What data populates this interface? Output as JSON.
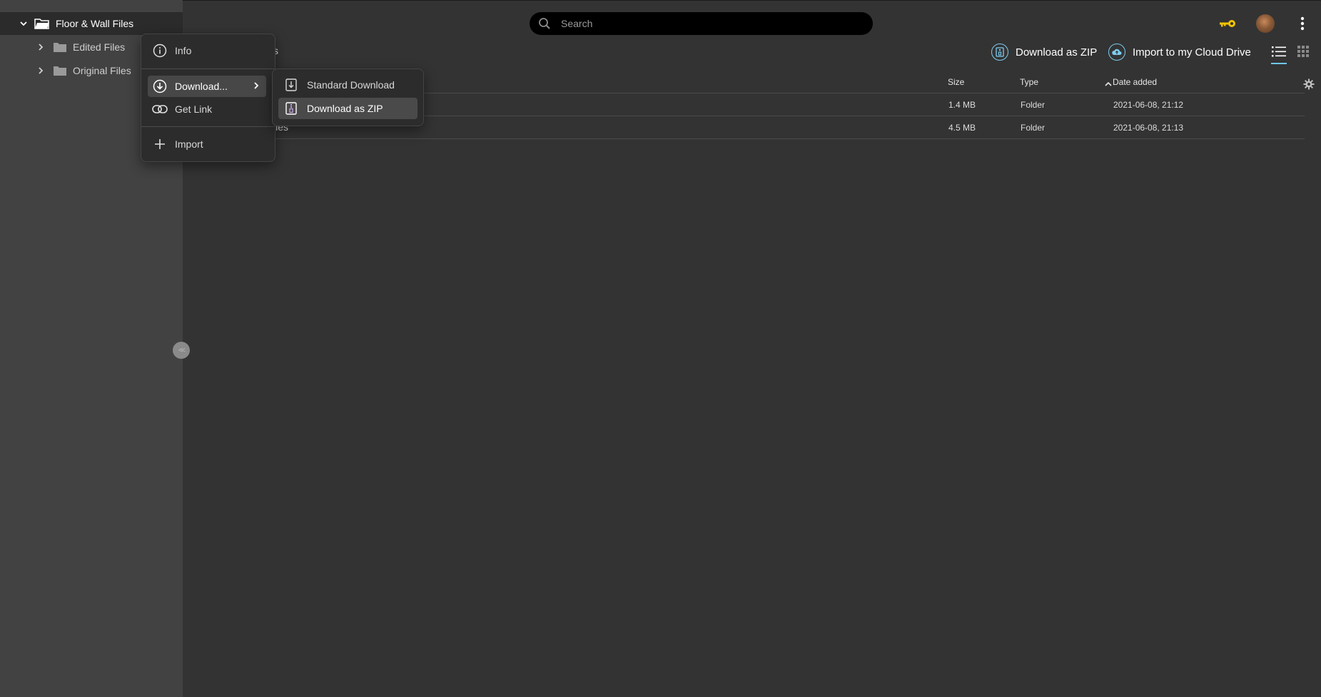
{
  "sidebar": {
    "root": {
      "label": "Floor & Wall Files",
      "icon": "folder-open-icon"
    },
    "children": [
      {
        "label": "Edited Files",
        "icon": "folder-icon"
      },
      {
        "label": "Original Files",
        "icon": "folder-icon"
      }
    ],
    "collapse_label": "<<"
  },
  "header": {
    "search_placeholder": "Search",
    "actions": {
      "download_zip": "Download as ZIP",
      "import_cloud": "Import to my Cloud Drive"
    }
  },
  "breadcrumb_fragment": "s",
  "table": {
    "columns": {
      "size": "Size",
      "type": "Type",
      "date": "Date added"
    },
    "rows": [
      {
        "name_fragment": "",
        "size": "1.4 MB",
        "type": "Folder",
        "date": "2021-06-08, 21:12"
      },
      {
        "name_fragment": "iles",
        "size": "4.5 MB",
        "type": "Folder",
        "date": "2021-06-08, 21:13"
      }
    ]
  },
  "context_menu": {
    "info": "Info",
    "download": "Download...",
    "get_link": "Get Link",
    "import": "Import",
    "submenu": {
      "standard": "Standard Download",
      "zip": "Download as ZIP"
    }
  },
  "colors": {
    "accent": "#6fc8ee",
    "key": "#f2c400",
    "background": "#333333",
    "sidebar": "#424242"
  }
}
